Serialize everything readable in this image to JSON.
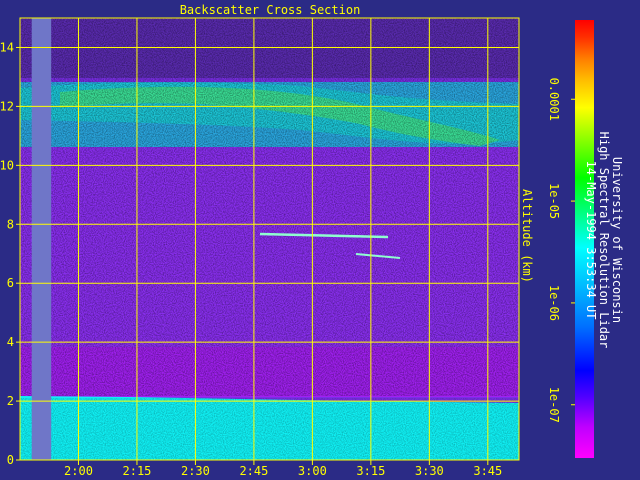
{
  "chart_data": {
    "type": "heatmap",
    "title": "Backscatter Cross Section",
    "ylabel": "Altitude (km)",
    "ylim": [
      0,
      15
    ],
    "xlim": [
      "1:45",
      "3:53"
    ],
    "x_ticks": [
      "2:00",
      "2:15",
      "2:30",
      "2:45",
      "3:00",
      "3:15",
      "3:30",
      "3:45"
    ],
    "y_ticks": [
      "0",
      "2",
      "4",
      "6",
      "8",
      "10",
      "12",
      "14"
    ],
    "colorbar": {
      "scale": "log",
      "range": [
        3e-08,
        0.0006
      ],
      "tick_labels": [
        "1e-07",
        "1e-06",
        "1e-05",
        "0.0001"
      ],
      "colors": [
        "#ff00ff",
        "#c000ff",
        "#5000ff",
        "#0000ff",
        "#0070ff",
        "#00c0ff",
        "#00ffff",
        "#00ff80",
        "#00ff00",
        "#80ff00",
        "#ffff00",
        "#ffc000",
        "#ff8000",
        "#ff3000",
        "#ff0000"
      ]
    },
    "features": [
      {
        "name": "boundary layer aerosol",
        "altitude_km": [
          0,
          2.1
        ],
        "level": "1e-06"
      },
      {
        "name": "cirrus",
        "altitude_km": [
          10.5,
          13.1
        ],
        "level": "1e-05"
      },
      {
        "name": "thin cloud",
        "altitude_km": [
          7.5,
          7.8
        ],
        "time": [
          "2:45",
          "3:20"
        ]
      },
      {
        "name": "thin cloud",
        "altitude_km": [
          6.8,
          7.0
        ],
        "time": [
          "3:18",
          "3:25"
        ]
      }
    ],
    "data_gap": [
      "1:48",
      "1:53"
    ],
    "grid": true
  },
  "side_text": {
    "line1": "University of Wisconsin",
    "line2": "High Spectral Resolution Lidar",
    "line3": "14-May-1994  3:53:34 UT"
  },
  "colors": {
    "background": "#2b2b86",
    "axes": "#ffff00",
    "grid": "#ffff00",
    "gap": "#6f76c8"
  }
}
